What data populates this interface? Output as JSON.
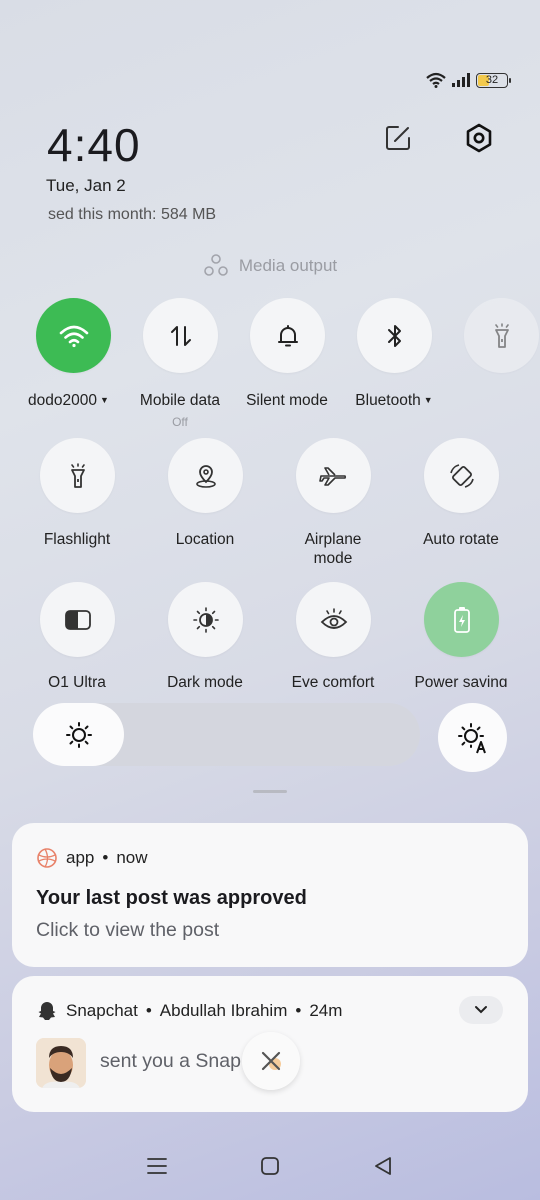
{
  "status_bar": {
    "battery_level": "32",
    "icons": [
      "wifi-icon",
      "signal-icon",
      "battery-icon"
    ]
  },
  "header": {
    "time": "4:40",
    "date": "Tue, Jan 2",
    "data_usage": "sed this month: 584 MB",
    "edit_icon": "edit-icon",
    "settings_icon": "settings-icon"
  },
  "media_output": {
    "label": "Media output"
  },
  "tiles_row1": [
    {
      "label": "dodo2000",
      "sub": "",
      "icon": "wifi-icon",
      "active": true,
      "dropdown": true
    },
    {
      "label": "Mobile data",
      "sub": "Off",
      "icon": "mobile-data-icon",
      "active": false,
      "dropdown": false
    },
    {
      "label": "Silent mode",
      "sub": "",
      "icon": "bell-icon",
      "active": false,
      "dropdown": false
    },
    {
      "label": "Bluetooth",
      "sub": "",
      "icon": "bluetooth-icon",
      "active": false,
      "dropdown": true
    },
    {
      "label": "",
      "sub": "",
      "icon": "flashlight-icon",
      "active": false,
      "dropdown": false
    }
  ],
  "tiles_row2": [
    {
      "label": "Flashlight",
      "icon": "flashlight-icon"
    },
    {
      "label": "Location",
      "icon": "location-icon"
    },
    {
      "label_line1": "Airplane",
      "label_line2": "mode",
      "icon": "airplane-icon"
    },
    {
      "label": "Auto rotate",
      "icon": "auto-rotate-icon"
    }
  ],
  "tiles_row3": [
    {
      "label": "O1 Ultra",
      "icon": "o1-ultra-icon"
    },
    {
      "label": "Dark mode",
      "icon": "dark-mode-icon"
    },
    {
      "label": "Eye comfort",
      "icon": "eye-icon"
    },
    {
      "label": "Power saving",
      "icon": "battery-saver-icon",
      "active": true
    }
  ],
  "brightness": {
    "level_fraction": 0.235,
    "auto_icon": "auto-brightness-icon"
  },
  "notifications": [
    {
      "app": "app",
      "time": "now",
      "title": "Your last post was approved",
      "body": "Click to view the post"
    },
    {
      "app": "Snapchat",
      "sender": "Abdullah Ibrahim",
      "time": "24m",
      "body": "sent you a Snap"
    }
  ],
  "separator": "•",
  "colors": {
    "accent_green": "#3dbb54",
    "power_saving_green": "#8fd19c",
    "tile_bg": "#f4f5f7"
  }
}
